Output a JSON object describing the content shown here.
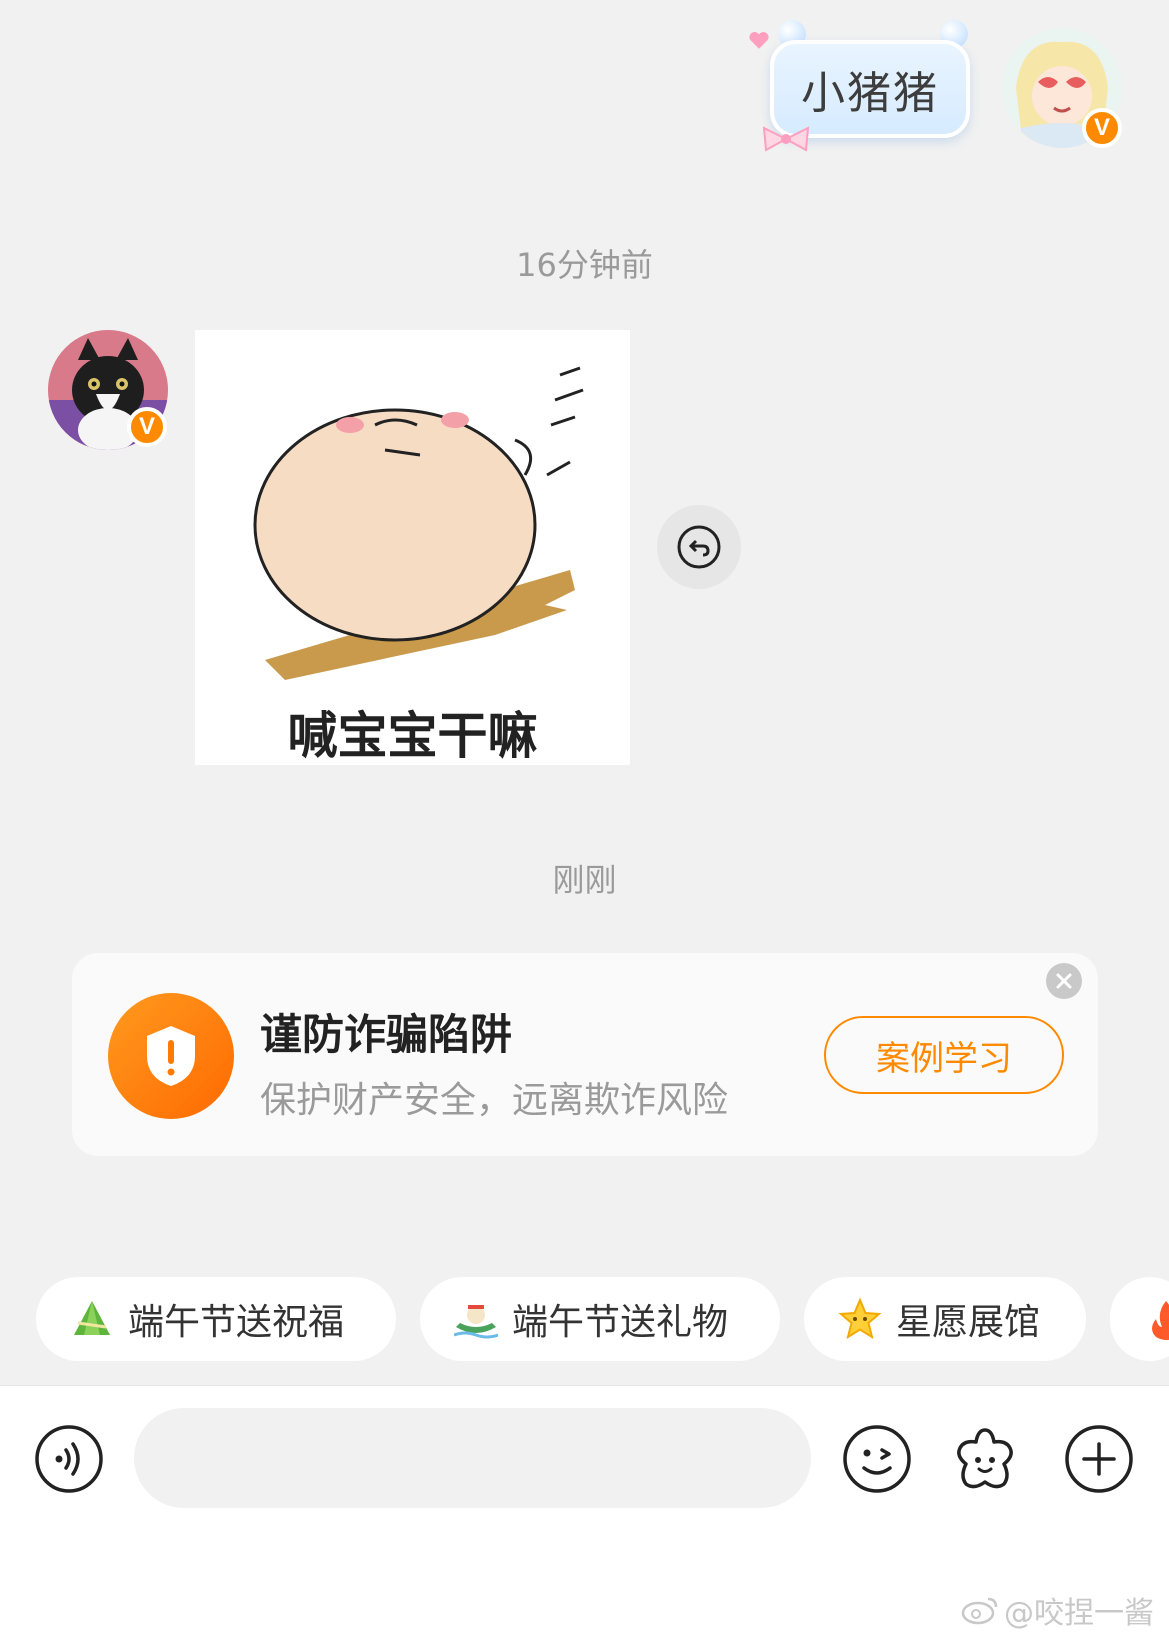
{
  "messages": {
    "outgoing_text": "小猪猪",
    "timestamp_1": "16分钟前",
    "incoming_sticker_caption": "喊宝宝干嘛",
    "timestamp_2": "刚刚"
  },
  "safety_card": {
    "title": "谨防诈骗陷阱",
    "subtitle": "保护财产安全，远离欺诈风险",
    "button_label": "案例学习"
  },
  "quick_chips": [
    {
      "label": "端午节送祝福",
      "icon": "zongzi-icon"
    },
    {
      "label": "端午节送礼物",
      "icon": "dragon-boat-icon"
    },
    {
      "label": "星愿展馆",
      "icon": "star-icon"
    },
    {
      "label": "",
      "icon": "fire-icon"
    }
  ],
  "input_bar": {
    "placeholder": "",
    "value": ""
  },
  "badges": {
    "verified": "V"
  },
  "watermark": "@咬捏一酱",
  "colors": {
    "accent": "#ff8a00",
    "background": "#f1f1f1",
    "card": "#fafafa"
  }
}
